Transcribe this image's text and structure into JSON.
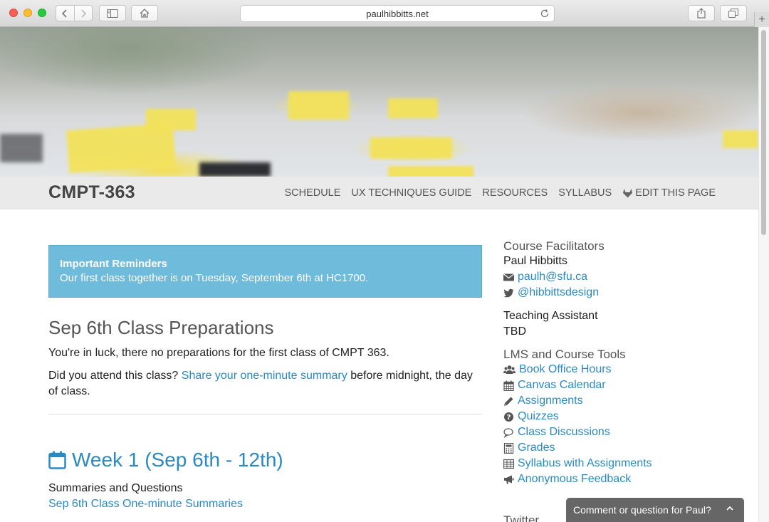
{
  "browser": {
    "url": "paulhibbitts.net"
  },
  "site": {
    "brand": "CMPT-363",
    "menu": [
      "SCHEDULE",
      "UX TECHNIQUES GUIDE",
      "RESOURCES",
      "SYLLABUS",
      "EDIT THIS PAGE"
    ]
  },
  "alert": {
    "title": "Important Reminders",
    "body": "Our first class together is on Tuesday, September 6th at HC1700."
  },
  "prep": {
    "heading": "Sep 6th Class Preparations",
    "p1": "You're in luck, there no preparations for the first class of CMPT 363.",
    "p2_before": "Did you attend this class? ",
    "p2_link": "Share your one-minute summary",
    "p2_after": " before midnight, the day of class."
  },
  "week": {
    "heading": "Week 1 (Sep 6th - 12th)",
    "summaries_label": "Summaries and Questions",
    "summaries_link": "Sep 6th Class One-minute Summaries"
  },
  "sidebar": {
    "facilitators_heading": "Course Facilitators",
    "facilitator_name": "Paul Hibbitts",
    "email": "paulh@sfu.ca",
    "twitter_handle": "@hibbittsdesign",
    "ta_label": "Teaching Assistant",
    "ta_name": "TBD",
    "tools_heading": "LMS and Course Tools",
    "tools": [
      {
        "label": "Book Office Hours",
        "icon": "users-icon"
      },
      {
        "label": "Canvas Calendar",
        "icon": "calendar-icon"
      },
      {
        "label": "Assignments",
        "icon": "pencil-icon"
      },
      {
        "label": "Quizzes",
        "icon": "question-circle-icon"
      },
      {
        "label": "Class Discussions",
        "icon": "comments-icon"
      },
      {
        "label": "Grades",
        "icon": "calculator-icon"
      },
      {
        "label": "Syllabus with Assignments",
        "icon": "table-icon"
      },
      {
        "label": "Anonymous Feedback",
        "icon": "bullhorn-icon"
      }
    ],
    "twitter_heading": "Twitter"
  },
  "feedback": {
    "label": "Comment or question for Paul?"
  },
  "colors": {
    "link": "#2a8ac0",
    "alert_bg": "#6fbbdb",
    "navbar_bg": "#eaeaea"
  }
}
